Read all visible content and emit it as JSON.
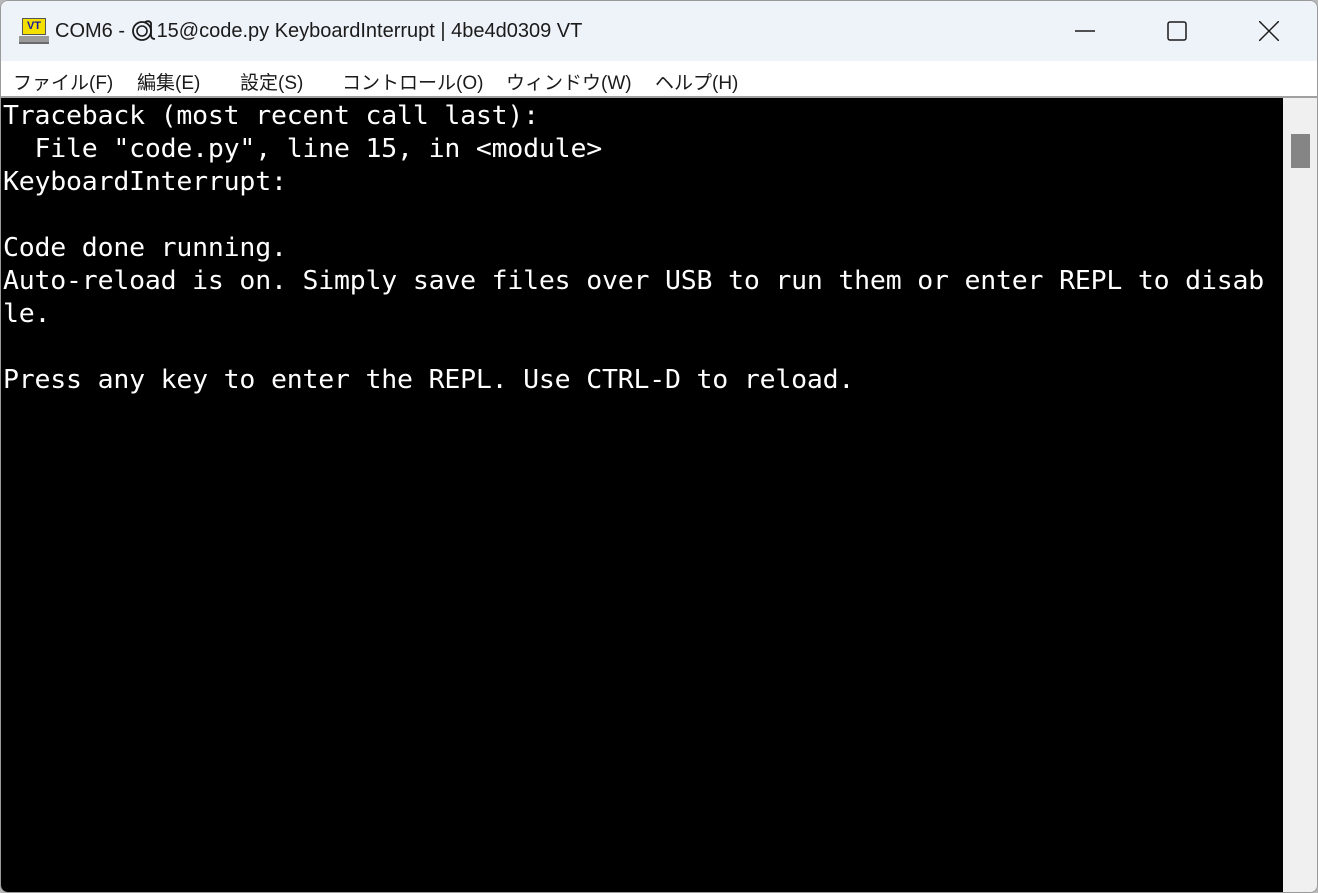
{
  "window": {
    "title": "COM6 - 🌀 15@code.py KeyboardInterrupt | 4be4d0309 VT",
    "title_parts": {
      "prefix": "COM6 - ",
      "suffix": "15@code.py KeyboardInterrupt | 4be4d0309 VT"
    },
    "app_icon_label": "VT",
    "controls": {
      "minimize": "minimize-icon",
      "maximize": "maximize-icon",
      "close": "close-icon"
    }
  },
  "menubar": {
    "items": [
      {
        "label": "ファイル(F)"
      },
      {
        "label": "編集(E)"
      },
      {
        "label": "設定(S)"
      },
      {
        "label": "コントロール(O)"
      },
      {
        "label": "ウィンドウ(W)"
      },
      {
        "label": "ヘルプ(H)"
      }
    ]
  },
  "terminal": {
    "lines": [
      "Traceback (most recent call last):",
      "  File \"code.py\", line 15, in <module>",
      "KeyboardInterrupt:",
      "",
      "Code done running.",
      "Auto-reload is on. Simply save files over USB to run them or enter REPL to disab",
      "le.",
      "",
      "Press any key to enter the REPL. Use CTRL-D to reload."
    ]
  },
  "colors": {
    "terminal_bg": "#000000",
    "terminal_fg": "#ffffff",
    "titlebar_bg": "#eef2f9",
    "menubar_bg": "#ffffff",
    "scrollbar_track": "#f0f0f0",
    "scrollbar_thumb": "#858585"
  }
}
